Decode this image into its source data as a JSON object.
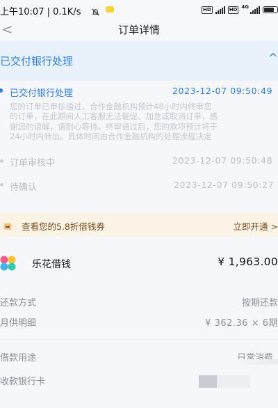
{
  "status_bar": {
    "time": "上午10:07 | 0.1K/s",
    "network_label": "4G"
  },
  "nav": {
    "back_symbol": "<",
    "title": "订单详情"
  },
  "status_header": {
    "title": "已交付银行处理",
    "chevron": "^"
  },
  "timeline": [
    {
      "label": "已交付银行处理",
      "time": "2023-12-07 09:50:49",
      "description": "您的订单已审核通过，合作金融机构预计48小时内终审您\n的订单，在此期间人工客服无法催促、加急或取消订单，感\n谢您的谅解，请耐心等待。终审通过后，您的款项预计将于\n24小时内转出。具体时间由合作金融机构的处理流程决定",
      "active": true
    },
    {
      "label": "订单审核中",
      "time": "2023-12-07 09:50:48",
      "active": false
    },
    {
      "label": "待确认",
      "time": "2023-12-07 09:50:27",
      "active": false
    }
  ],
  "coupon": {
    "text": "查看您的5.8折借钱券",
    "action": "立即开通 >"
  },
  "product": {
    "name": "乐花借钱",
    "amount": "¥ 1,963.00"
  },
  "details": {
    "repay_method_label": "还款方式",
    "repay_method_value": "按期还款",
    "monthly_label": "月供明细",
    "monthly_value": "¥ 362.36 × 6期",
    "purpose_label": "借款用途",
    "purpose_value": "日常消费",
    "bank_card_label": "收款银行卡"
  },
  "colors": {
    "accent": "#2f7de1",
    "header_bg": "#e9f2fb",
    "coupon_bg": "#fbf3e6",
    "coupon_text": "#7a4a1c"
  }
}
